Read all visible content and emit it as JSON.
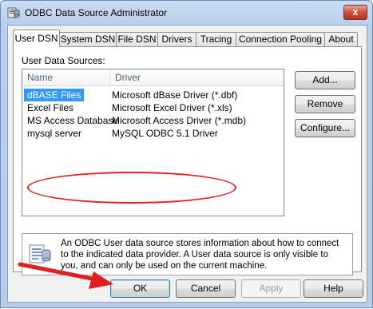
{
  "window": {
    "title": "ODBC Data Source Administrator",
    "close_label": "x"
  },
  "tabs": [
    {
      "label": "User DSN"
    },
    {
      "label": "System DSN"
    },
    {
      "label": "File DSN"
    },
    {
      "label": "Drivers"
    },
    {
      "label": "Tracing"
    },
    {
      "label": "Connection Pooling"
    },
    {
      "label": "About"
    }
  ],
  "panel": {
    "sources_label": "User Data Sources:",
    "columns": {
      "name": "Name",
      "driver": "Driver"
    },
    "rows": [
      {
        "name": "dBASE Files",
        "driver": "Microsoft dBase Driver (*.dbf)"
      },
      {
        "name": "Excel Files",
        "driver": "Microsoft Excel Driver (*.xls)"
      },
      {
        "name": "MS Access Database",
        "driver": "Microsoft Access Driver (*.mdb)"
      },
      {
        "name": "mysql server",
        "driver": "MySQL ODBC 5.1 Driver"
      }
    ],
    "selected_row": 0,
    "buttons": {
      "add": "Add...",
      "remove": "Remove",
      "configure": "Configure..."
    },
    "info_text": "An ODBC User data source stores information about how to connect to the indicated data provider.   A User data source is only visible to you, and can only be used on the current machine."
  },
  "footer": {
    "ok": "OK",
    "cancel": "Cancel",
    "apply": "Apply",
    "help": "Help"
  },
  "annotations": {
    "highlight_color": "#e02020"
  }
}
